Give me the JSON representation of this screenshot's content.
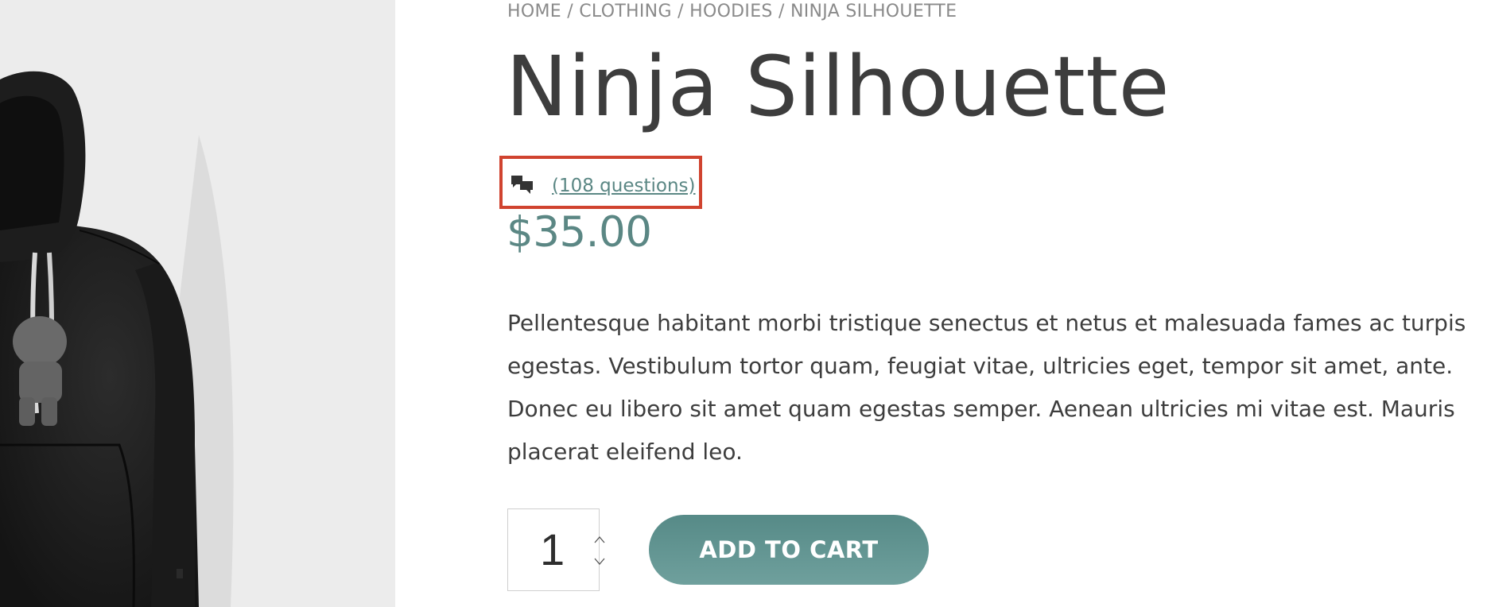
{
  "breadcrumb": {
    "home": "HOME",
    "sep1": " / ",
    "clothing": "CLOTHING",
    "sep2": " / ",
    "hoodies": "HOODIES",
    "sep3": " / ",
    "current": "NINJA SILHOUETTE"
  },
  "product": {
    "title": "Ninja Silhouette",
    "questions_link": "(108 questions)",
    "questions_icon": "chat-bubbles-icon",
    "price": "$35.00",
    "description": "Pellentesque habitant morbi tristique senectus et netus et malesuada fames ac turpis egestas. Vestibulum tortor quam, feugiat vitae, ultricies eget, tempor sit amet, ante. Donec eu libero sit amet quam egestas semper. Aenean ultricies mi vitae est. Mauris placerat eleifend leo.",
    "image_icon": "black-hoodie-product-image"
  },
  "cart": {
    "quantity": "1",
    "add_to_cart_label": "ADD TO CART"
  },
  "colors": {
    "accent": "#5b8784",
    "highlight_border": "#d0432f",
    "text": "#3d3d3d",
    "muted": "#8a8a8a",
    "image_background": "#ececec"
  }
}
